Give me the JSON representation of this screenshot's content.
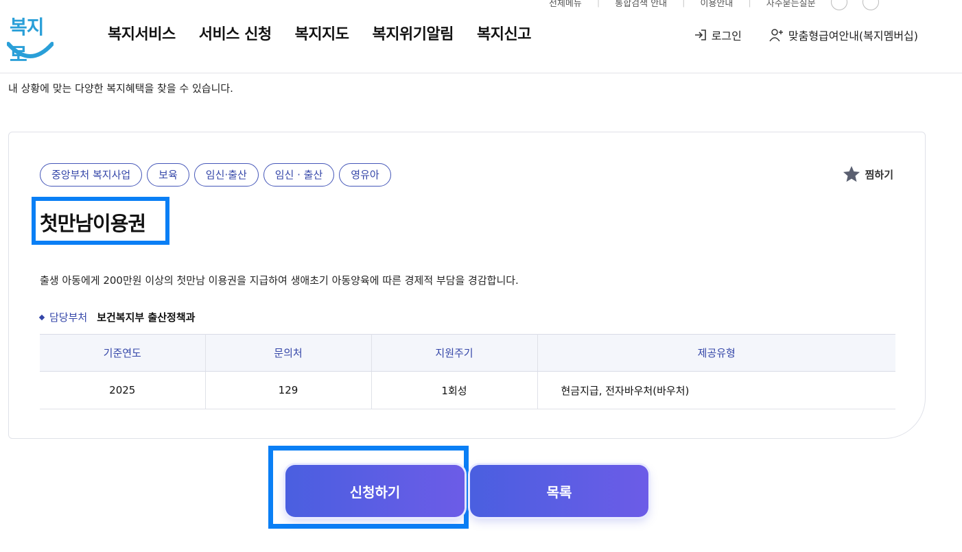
{
  "header": {
    "util_links": [
      "전체메뉴",
      "통합검색 안내",
      "이용안내",
      "자주묻는질문"
    ],
    "logo_text": "복지로",
    "nav": [
      "복지서비스",
      "서비스 신청",
      "복지지도",
      "복지위기알림",
      "복지신고"
    ],
    "login_label": "로그인",
    "membership_label": "맞춤형급여안내(복지멤버십)"
  },
  "intro_text": "내 상황에 맞는 다양한 복지혜택을 찾을 수 있습니다.",
  "service": {
    "tags": [
      "중앙부처 복지사업",
      "보육",
      "임신·출산",
      "임신 · 출산",
      "영유아"
    ],
    "favorite_label": "찜하기",
    "title": "첫만남이용권",
    "description": "출생 아동에게 200만원 이상의 첫만남 이용권을 지급하여 생애초기 아동양육에 따른 경제적 부담을 경감합니다.",
    "dept_label": "담당부처",
    "dept_value": "보건복지부 출산정책과",
    "table": {
      "headers": [
        "기준연도",
        "문의처",
        "지원주기",
        "제공유형"
      ],
      "row": [
        "2025",
        "129",
        "1회성",
        "현금지급, 전자바우처(바우처)"
      ]
    }
  },
  "buttons": {
    "apply": "신청하기",
    "list": "목록"
  },
  "colors": {
    "brand": "#2a9fd8",
    "accent": "#3446a8",
    "highlight_box": "#0a7ff5",
    "button_gradient_start": "#4a5fe0",
    "button_gradient_end": "#6c5ce7"
  },
  "icons": {
    "login": "login-arrow-icon",
    "membership": "user-plus-icon",
    "favorite": "star-icon"
  }
}
